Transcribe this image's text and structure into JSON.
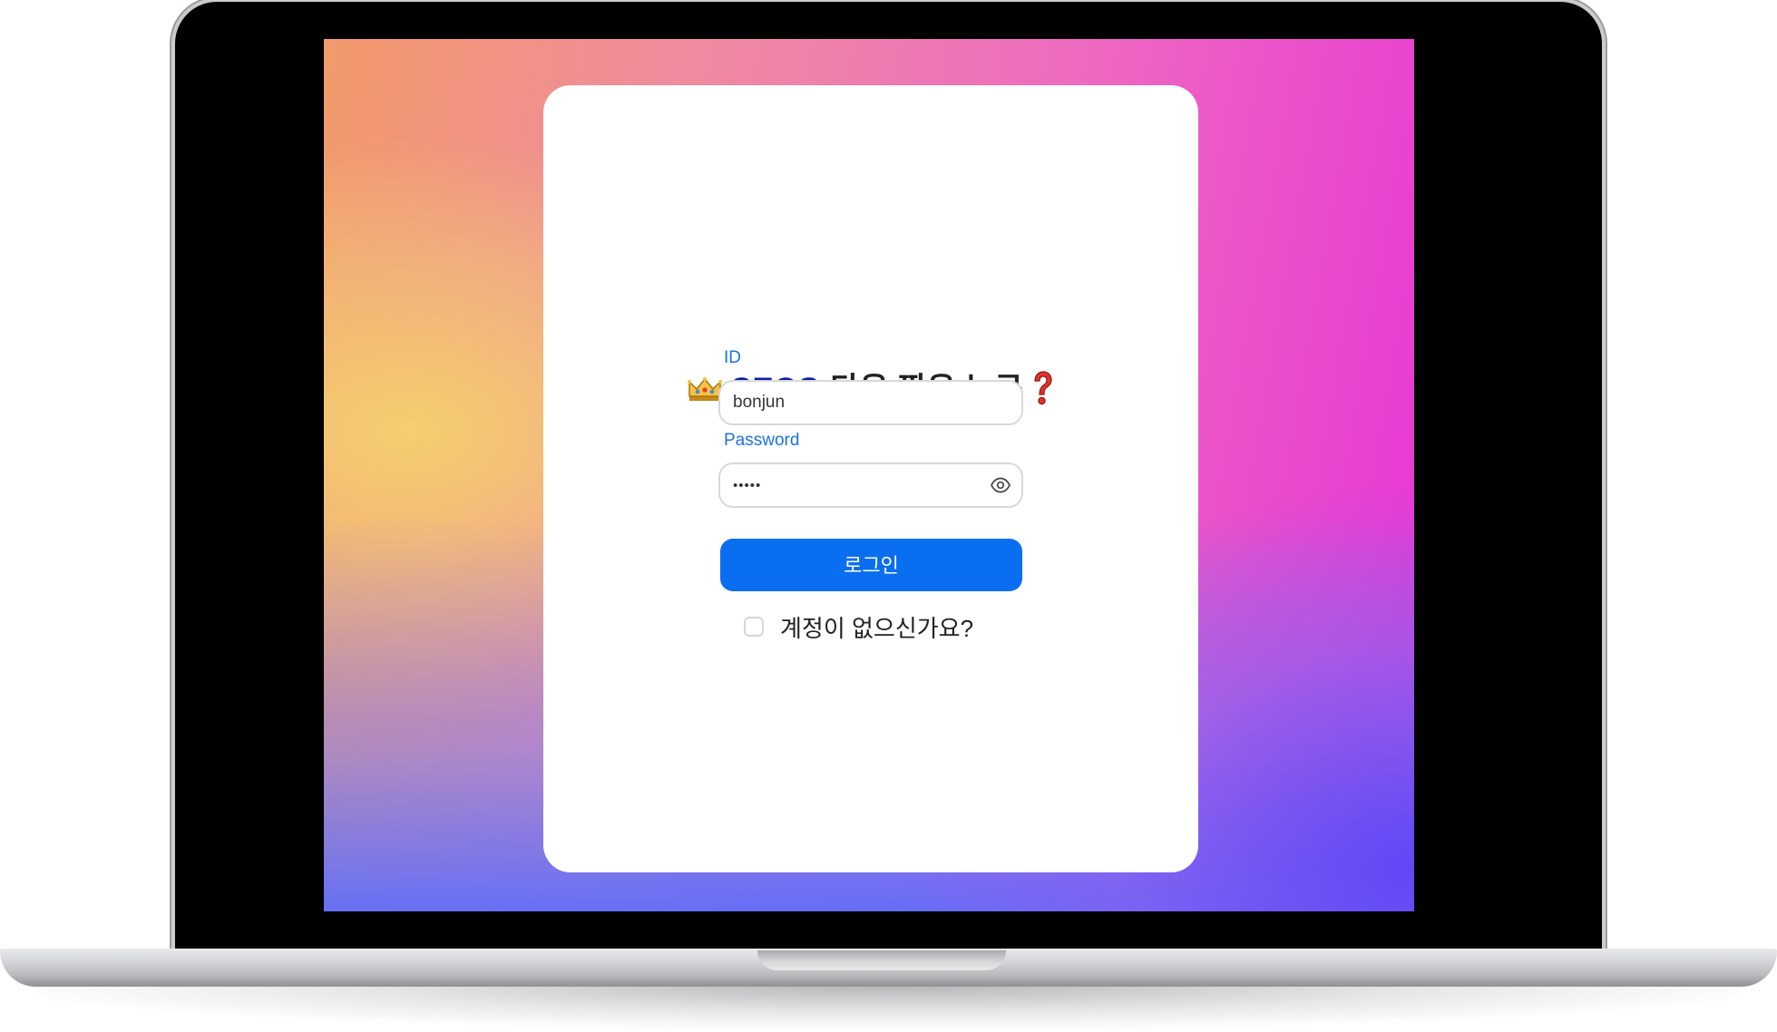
{
  "login": {
    "title_brand": "CEOS",
    "title_text": "다음 짱은 누구",
    "title_icons": [
      "crown-icon",
      "question-mark-icon"
    ],
    "id_label": "ID",
    "id_value": "bonjun",
    "password_label": "Password",
    "password_value": "•••••",
    "password_toggle_icon": "eye-icon",
    "login_button": "로그인",
    "signup_text": "계정이 없으신가요?"
  },
  "colors": {
    "brand": "#0b1ea3",
    "label": "#1a73e8",
    "button": "#0a6ef0"
  }
}
